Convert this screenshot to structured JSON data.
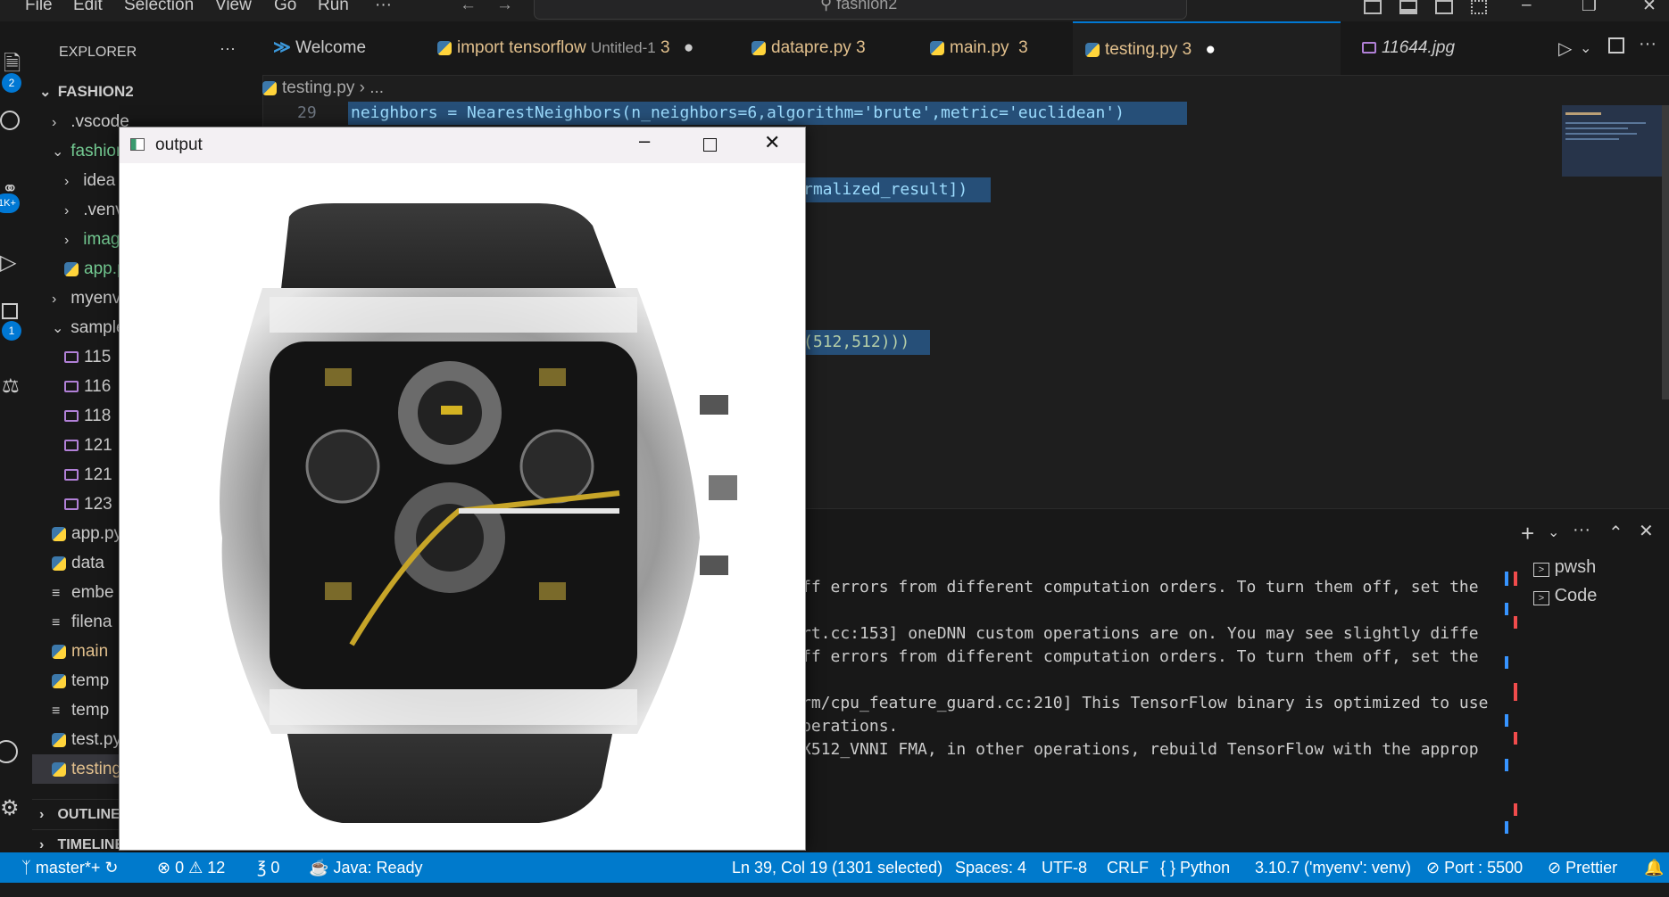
{
  "menu": [
    "File",
    "Edit",
    "Selection",
    "View",
    "Go",
    "Run",
    "···"
  ],
  "command_center": "fashion2",
  "activity_badges": {
    "explorer": "2",
    "source_control": "1K+",
    "extensions": "1"
  },
  "explorer": {
    "header": "EXPLORER",
    "root": "FASHION2",
    "items": [
      ".vscode",
      "fashion",
      "idea",
      ".venv",
      "images",
      "app.py",
      "myenv",
      "sample",
      "115",
      "116",
      "118",
      "121",
      "121",
      "123",
      "app.py",
      "data",
      "embe",
      "filena",
      "main",
      "temp",
      "temp",
      "test.py",
      "testing"
    ],
    "outline": "OUTLINE",
    "timeline": "TIMELINE"
  },
  "tabs": [
    {
      "label": "Welcome",
      "badge": ""
    },
    {
      "label": "import tensorflow",
      "sub": "Untitled-1",
      "badge": "3"
    },
    {
      "label": "datapre.py",
      "badge": "3"
    },
    {
      "label": "main.py",
      "badge": "3"
    },
    {
      "label": "testing.py",
      "badge": "3"
    },
    {
      "label": "11644.jpg",
      "badge": ""
    }
  ],
  "breadcrumb": "testing.py › ...",
  "code": {
    "line_number": "29",
    "line29": "neighbors = NearestNeighbors(n_neighbors=6,algorithm='brute',metric='euclidean')",
    "frag1": "rmalized_result])",
    "frag2": "(512,512)))"
  },
  "terminal": {
    "lines": [
      "ff errors from different computation orders. To turn them off, set the",
      "rt.cc:153] oneDNN custom operations are on. You may see slightly diffe",
      "ff errors from different computation orders. To turn them off, set the",
      "rm/cpu_feature_guard.cc:210] This TensorFlow binary is optimized to use",
      "perations.",
      "X512_VNNI FMA, in other operations, rebuild TensorFlow with the approp"
    ],
    "sessions": [
      "pwsh",
      "Code"
    ]
  },
  "output_window": {
    "title": "output"
  },
  "status": {
    "branch": "master*+",
    "errors": "0",
    "warnings": "12",
    "ports": "0",
    "java": "Java: Ready",
    "position": "Ln 39, Col 19 (1301 selected)",
    "spaces": "Spaces: 4",
    "encoding": "UTF-8",
    "eol": "CRLF",
    "language": "Python",
    "interpreter": "3.10.7 ('myenv': venv)",
    "port": "Port : 5500",
    "prettier": "Prettier"
  }
}
